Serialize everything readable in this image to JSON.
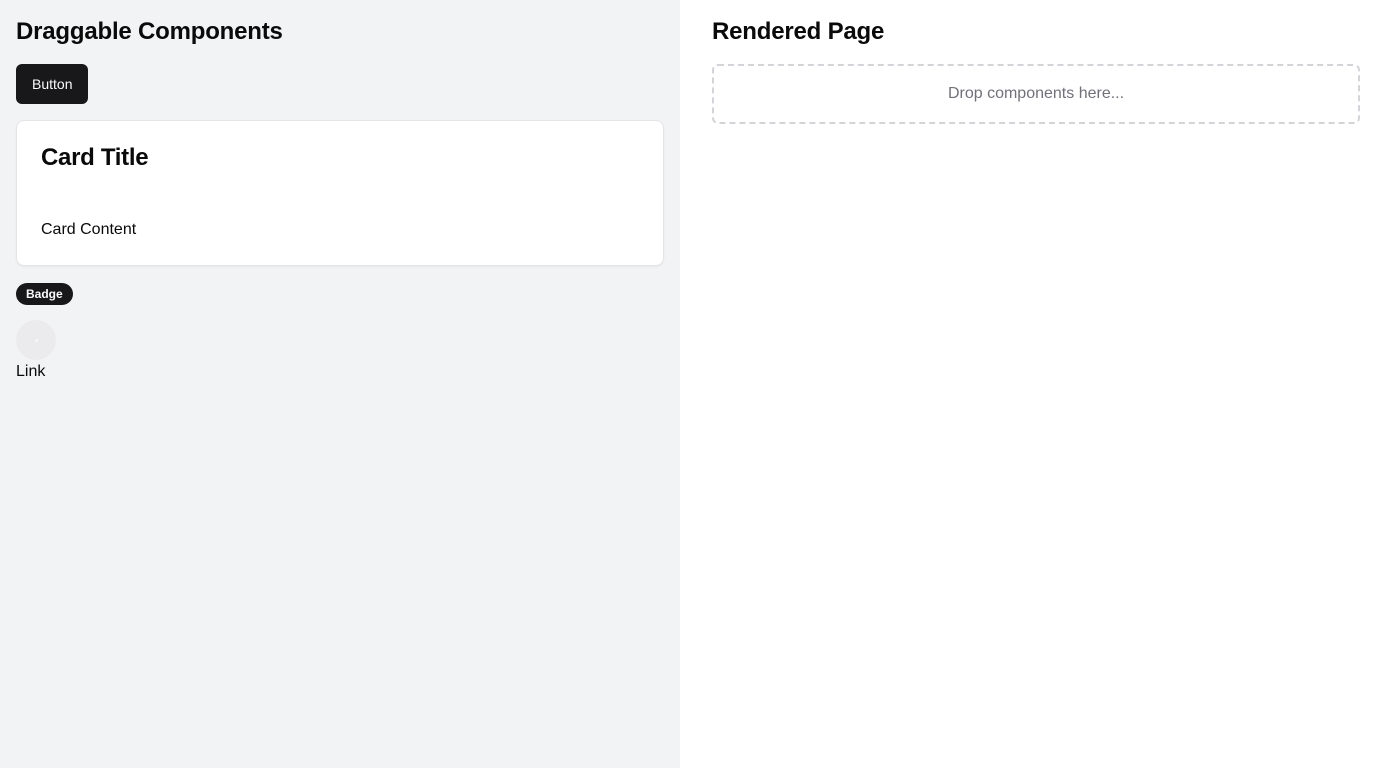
{
  "palette": {
    "title": "Draggable Components",
    "button_label": "Button",
    "card": {
      "title": "Card Title",
      "content": "Card Content"
    },
    "badge_label": "Badge",
    "avatar_icon": "avatar-placeholder-icon",
    "link_label": "Link"
  },
  "canvas": {
    "title": "Rendered Page",
    "dropzone_text": "Drop components here..."
  },
  "colors": {
    "palette_bg": "#f2f3f5",
    "primary": "#18181b",
    "dropzone_border": "#d4d4d8",
    "muted_text": "#71717a"
  }
}
